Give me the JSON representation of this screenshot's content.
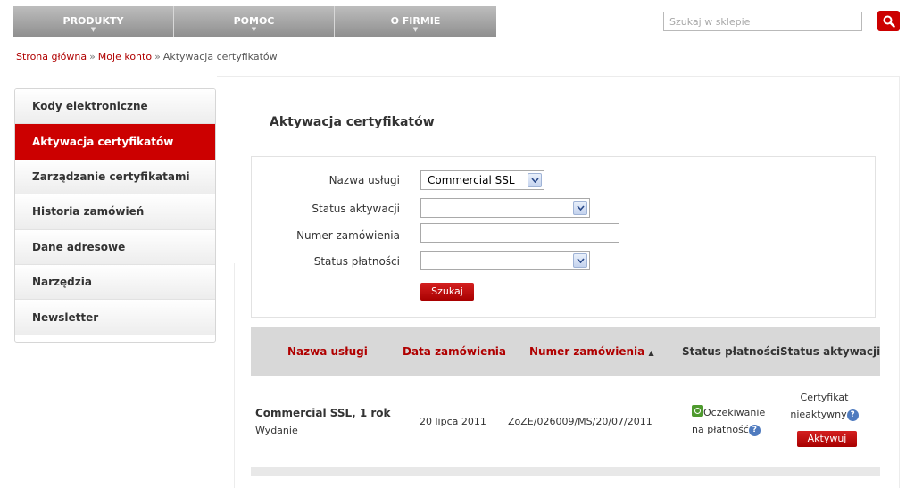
{
  "nav": {
    "items": [
      {
        "label": "PRODUKTY"
      },
      {
        "label": "POMOC"
      },
      {
        "label": "O FIRMIE"
      }
    ]
  },
  "search": {
    "placeholder": "Szukaj w sklepie"
  },
  "breadcrumb": {
    "home": "Strona główna",
    "separator": "»",
    "account": "Moje konto",
    "current": "Aktywacja certyfikatów"
  },
  "sidebar": {
    "items": [
      {
        "label": "Kody elektroniczne"
      },
      {
        "label": "Aktywacja certyfikatów"
      },
      {
        "label": "Zarządzanie certyfikatami"
      },
      {
        "label": "Historia zamówień"
      },
      {
        "label": "Dane adresowe"
      },
      {
        "label": "Narzędzia"
      },
      {
        "label": "Newsletter"
      }
    ]
  },
  "page": {
    "title": "Aktywacja certyfikatów"
  },
  "filter": {
    "service_label": "Nazwa usługi",
    "service_value": "Commercial SSL",
    "activation_label": "Status aktywacji",
    "activation_value": "",
    "order_label": "Numer zamówienia",
    "order_value": "",
    "payment_label": "Status płatności",
    "payment_value": "",
    "search_button": "Szukaj"
  },
  "table": {
    "headers": {
      "service": "Nazwa usługi",
      "date": "Data zamówienia",
      "order": "Numer zamówienia",
      "sort_arrow": "▲",
      "payment": "Status płatności",
      "activation": "Status aktywacji"
    },
    "rows": [
      {
        "service": "Commercial SSL, 1 rok",
        "service_type": "Wydanie",
        "date": "20 lipca 2011",
        "order": "ZoZE/026009/MS/20/07/2011",
        "payment_line1": "Oczekiwanie",
        "payment_line2": "na płatność",
        "activation_line1": "Certyfikat",
        "activation_line2": "nieaktywny",
        "activate_button": "Aktywuj"
      }
    ]
  },
  "colors": {
    "accent": "#cc0000",
    "link": "#b00000"
  }
}
